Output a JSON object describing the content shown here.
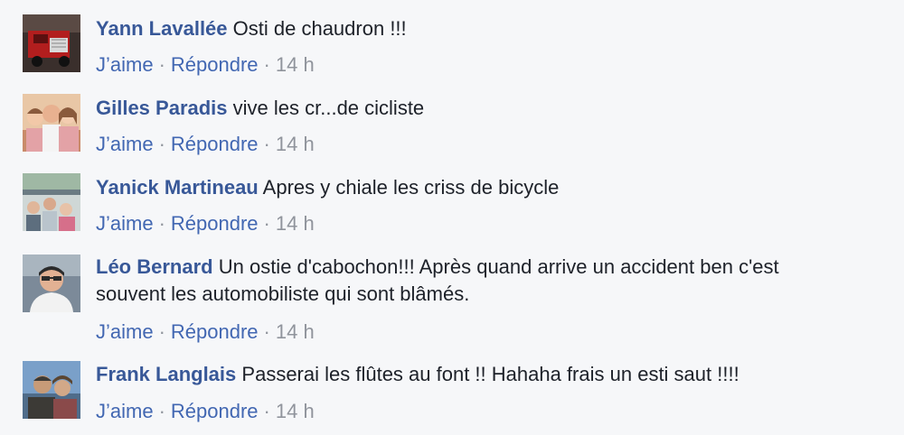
{
  "comments": [
    {
      "author": "Yann Lavallée",
      "text_lines": [
        "Osti de chaudron !!!"
      ],
      "like_label": "J’aime",
      "reply_label": "Répondre",
      "time": "14 h",
      "avatar_icon": "red-truck-photo",
      "colors": {
        "bg": "#3a2f2c",
        "main": "#b21e1e",
        "accent": "#d9d9d9"
      }
    },
    {
      "author": "Gilles Paradis",
      "text_lines": [
        "vive les cr...de cicliste"
      ],
      "like_label": "J’aime",
      "reply_label": "Répondre",
      "time": "14 h",
      "avatar_icon": "family-photo",
      "colors": {
        "bg": "#e9c7a6",
        "main": "#e3a2a6",
        "accent": "#8a5a3c"
      }
    },
    {
      "author": "Yanick Martineau",
      "text_lines": [
        "Apres y chiale les criss de bicycle"
      ],
      "like_label": "J’aime",
      "reply_label": "Répondre",
      "time": "14 h",
      "avatar_icon": "group-outdoor-photo",
      "colors": {
        "bg": "#9fb8a4",
        "main": "#cfd7d6",
        "accent": "#6b7b83"
      }
    },
    {
      "author": "Léo Bernard",
      "text_lines": [
        "Un ostie d'cabochon!!! Après quand arrive un accident ben c'est",
        "souvent les automobiliste qui sont blâmés."
      ],
      "like_label": "J’aime",
      "reply_label": "Répondre",
      "time": "14 h",
      "avatar_icon": "man-with-sunglasses-photo",
      "colors": {
        "bg": "#7c8a99",
        "main": "#f2f2f2",
        "accent": "#2b2b2b"
      }
    },
    {
      "author": "Frank Langlais",
      "text_lines": [
        "Passerai les flûtes au font !! Hahaha frais un esti saut !!!!"
      ],
      "like_label": "J’aime",
      "reply_label": "Répondre",
      "time": "14 h",
      "avatar_icon": "two-people-photo",
      "colors": {
        "bg": "#7aa0c9",
        "main": "#3c3a36",
        "accent": "#c79b78"
      }
    }
  ]
}
